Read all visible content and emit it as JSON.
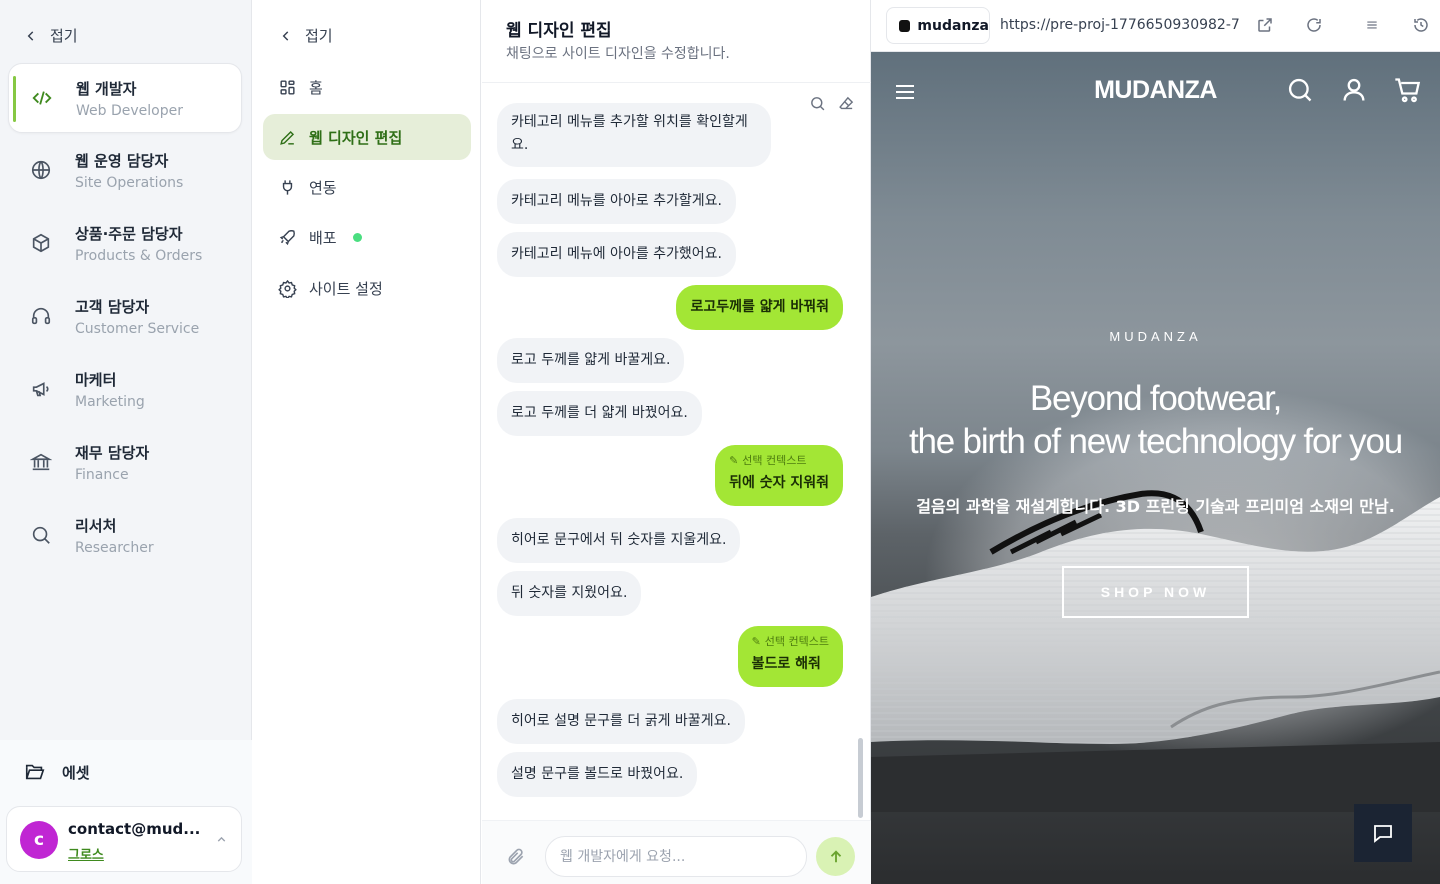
{
  "sidebar": {
    "collapse_label": "접기",
    "roles": [
      {
        "title": "웹 개발자",
        "subtitle": "Web Developer",
        "icon": "code-icon",
        "active": true
      },
      {
        "title": "웹 운영 담당자",
        "subtitle": "Site Operations",
        "icon": "globe-icon"
      },
      {
        "title": "상품·주문 담당자",
        "subtitle": "Products & Orders",
        "icon": "box-icon"
      },
      {
        "title": "고객 담당자",
        "subtitle": "Customer Service",
        "icon": "headphones-icon"
      },
      {
        "title": "마케터",
        "subtitle": "Marketing",
        "icon": "megaphone-icon"
      },
      {
        "title": "재무 담당자",
        "subtitle": "Finance",
        "icon": "bank-icon"
      },
      {
        "title": "리서처",
        "subtitle": "Researcher",
        "icon": "search-icon"
      }
    ],
    "assets_label": "에셋",
    "account": {
      "avatar_letter": "c",
      "email": "contact@mud...",
      "plan": "그로스"
    }
  },
  "subnav": {
    "collapse_label": "접기",
    "items": [
      {
        "label": "홈",
        "icon": "grid-icon"
      },
      {
        "label": "웹 디자인 편집",
        "icon": "pencil-icon",
        "active": true
      },
      {
        "label": "연동",
        "icon": "plug-icon"
      },
      {
        "label": "배포",
        "icon": "rocket-icon",
        "status": "live"
      },
      {
        "label": "사이트 설정",
        "icon": "gear-icon"
      }
    ]
  },
  "chat": {
    "title": "웹 디자인 편집",
    "subtitle": "채팅으로 사이트 디자인을 수정합니다.",
    "messages": [
      {
        "role": "bot",
        "text": "카테고리 메뉴를 추가할 위치를 확인할게요."
      },
      {
        "role": "bot",
        "text": "카테고리 메뉴를 아아로 추가할게요."
      },
      {
        "role": "bot",
        "text": "카테고리 메뉴에 아아를 추가했어요."
      },
      {
        "role": "user",
        "text": "로고두께를 얇게 바꿔줘"
      },
      {
        "role": "bot",
        "text": "로고 두께를 얇게 바꿀게요."
      },
      {
        "role": "bot",
        "text": "로고 두께를 더 얇게 바꿨어요."
      },
      {
        "role": "user",
        "context": "선택 컨텍스트",
        "text": "뒤에 숫자 지워줘"
      },
      {
        "role": "bot",
        "text": "히어로 문구에서 뒤 숫자를 지울게요."
      },
      {
        "role": "bot",
        "text": "뒤 숫자를 지웠어요."
      },
      {
        "role": "user",
        "context": "선택 컨텍스트",
        "text": "볼드로 해줘"
      },
      {
        "role": "bot",
        "text": "히어로 설명 문구를 더 굵게 바꿀게요."
      },
      {
        "role": "bot",
        "text": "설명 문구를 볼드로 바꿨어요."
      }
    ],
    "input_placeholder": "웹 개발자에게 요청..."
  },
  "preview": {
    "tab_label": "mudanza",
    "url": "https://pre-proj-1776650930982-7...",
    "site": {
      "logo": "MUDANZA",
      "hero_brand": "MUDANZA",
      "hero_title_line1": "Beyond footwear,",
      "hero_title_line2": "the birth of new technology for you",
      "hero_desc": "걸음의 과학을 재설계합니다. 3D 프린팅 기술과 프리미엄 소재의 만남.",
      "cta": "SHOP NOW"
    }
  },
  "colors": {
    "accent": "#a3e635",
    "accent_dark": "#3f8a1e",
    "avatar": "#c026d3",
    "status_live": "#4ade80",
    "chat_fab": "#1b2433"
  }
}
